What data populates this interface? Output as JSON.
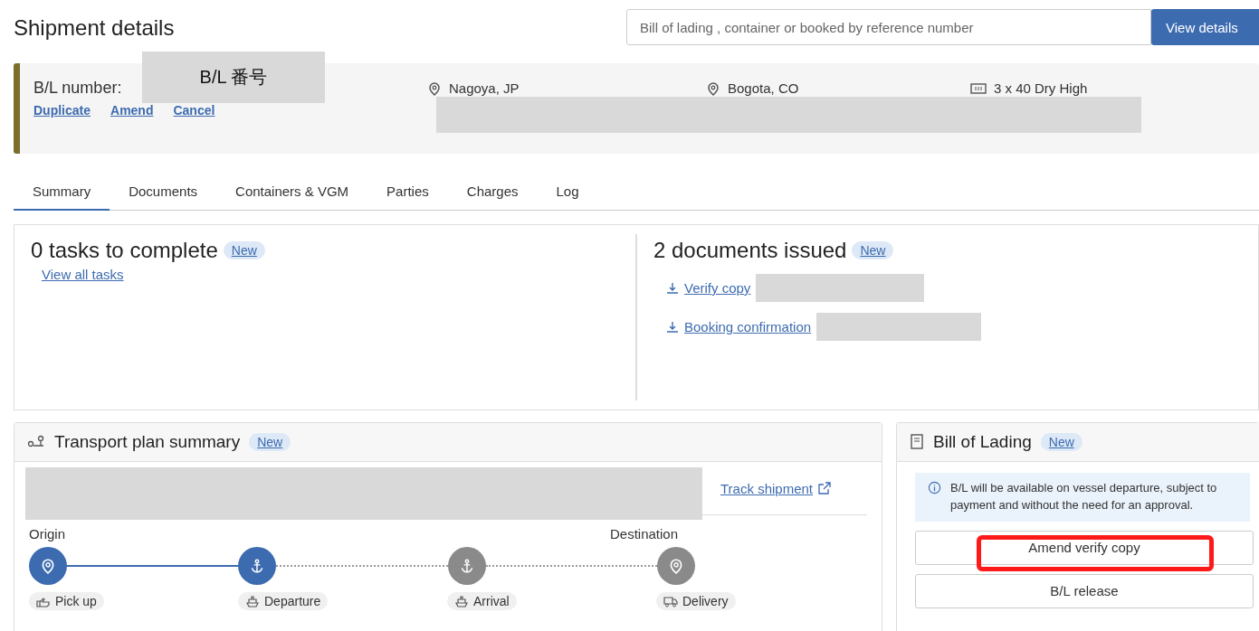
{
  "page": {
    "title": "Shipment details"
  },
  "search": {
    "placeholder": "Bill of lading , container or booked by reference number",
    "button": "View details"
  },
  "header": {
    "bl_label": "B/L number:",
    "bl_value": "B/L 番号",
    "actions": [
      "Duplicate",
      "Amend",
      "Cancel"
    ],
    "origin": "Nagoya, JP",
    "destination": "Bogota, CO",
    "equipment": "3 x 40 Dry High"
  },
  "tabs": [
    {
      "label": "Summary",
      "selected": true
    },
    {
      "label": "Documents",
      "selected": false
    },
    {
      "label": "Containers & VGM",
      "selected": false
    },
    {
      "label": "Parties",
      "selected": false
    },
    {
      "label": "Charges",
      "selected": false
    },
    {
      "label": "Log",
      "selected": false
    }
  ],
  "tasks": {
    "title": "0 tasks to complete",
    "badge": "New",
    "link": "View all tasks"
  },
  "documents": {
    "title": "2 documents issued",
    "badge": "New",
    "items": [
      "Verify copy",
      "Booking confirmation"
    ]
  },
  "transport": {
    "title": "Transport plan summary",
    "badge": "New",
    "link": "Track shipment",
    "origin_label": "Origin",
    "destination_label": "Destination",
    "steps": [
      {
        "kind": "pin",
        "done": true,
        "tag": {
          "label": "Pick up",
          "kind": "hand"
        }
      },
      {
        "kind": "anchor",
        "done": true,
        "tag": {
          "label": "Departure",
          "kind": "ship"
        }
      },
      {
        "kind": "anchor",
        "done": false,
        "tag": {
          "label": "Arrival",
          "kind": "ship"
        }
      },
      {
        "kind": "pin",
        "done": false,
        "tag": {
          "label": "Delivery",
          "kind": "truck"
        }
      }
    ]
  },
  "bill": {
    "title": "Bill of Lading",
    "badge": "New",
    "info": "B/L will be available on vessel departure, subject to payment and without the need for an approval.",
    "buttons": [
      {
        "label": "Amend verify copy",
        "highlighted": true
      },
      {
        "label": "B/L release",
        "highlighted": false
      }
    ]
  }
}
